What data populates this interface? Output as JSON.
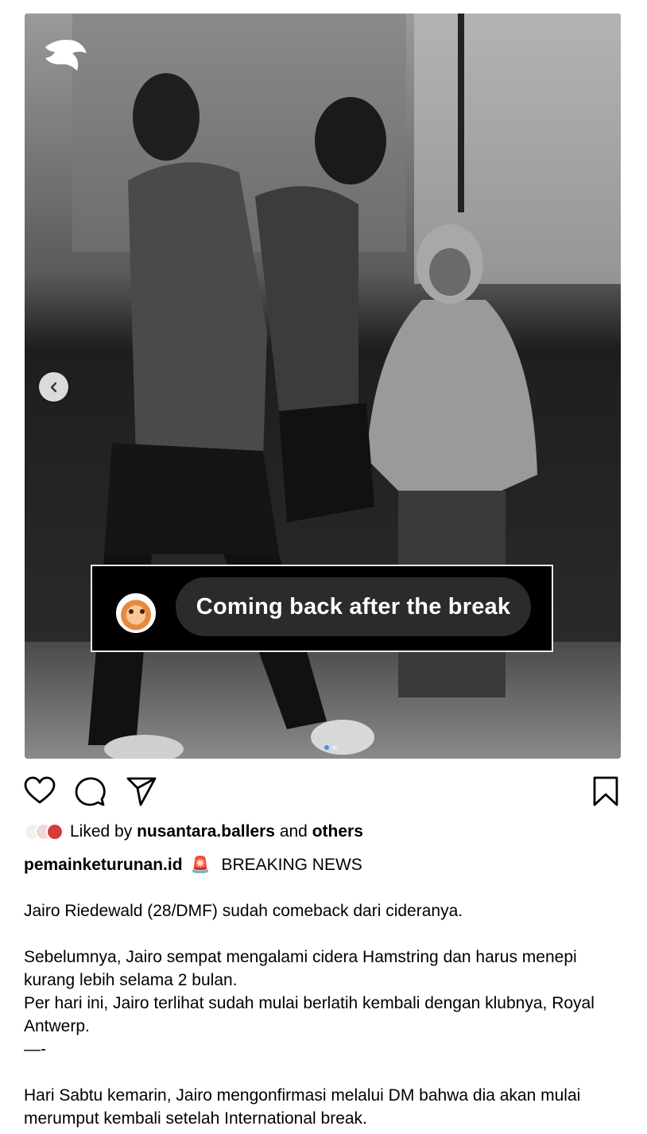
{
  "post": {
    "story_caption": "Coming back after the break",
    "carousel_dots": 2,
    "active_dot": 0
  },
  "actions": {
    "like_icon": "heart-icon",
    "comment_icon": "comment-icon",
    "share_icon": "share-icon",
    "save_icon": "bookmark-icon"
  },
  "likes": {
    "prefix": "Liked by",
    "user": "nusantara.ballers",
    "middle": "and",
    "others": "others"
  },
  "caption": {
    "username": "pemainketurunan.id",
    "headline_emoji": "🚨",
    "headline": "BREAKING NEWS",
    "body": "Jairo Riedewald (28/DMF) sudah comeback dari cideranya.\n\nSebelumnya, Jairo sempat mengalami cidera Hamstring dan harus menepi kurang lebih selama 2 bulan.\nPer hari ini, Jairo terlihat sudah mulai berlatih kembali dengan klubnya, Royal Antwerp.\n—-\n\nHari Sabtu kemarin, Jairo mengonfirmasi melalui DM bahwa dia akan mulai merumput kembali setelah International break."
  },
  "colors": {
    "accent": "#3897f0",
    "text": "#000000",
    "pill_bg": "#2b2b2b"
  }
}
